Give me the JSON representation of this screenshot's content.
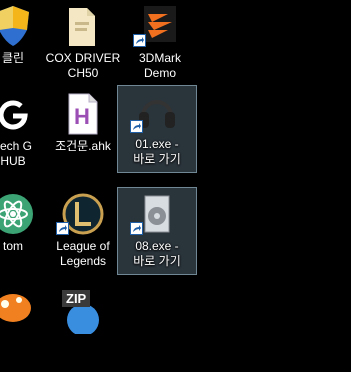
{
  "desktop": {
    "icons": [
      {
        "id": "clean",
        "label": "클린",
        "icon": "shield-cleaner-icon"
      },
      {
        "id": "cox",
        "label": "COX DRIVER\nCH50",
        "icon": "folder-icon"
      },
      {
        "id": "3dmark",
        "label": "3DMark\nDemo",
        "icon": "3dmark-icon"
      },
      {
        "id": "ghub",
        "label": "itech G\nHUB",
        "icon": "logitech-g-icon"
      },
      {
        "id": "ahk",
        "label": "조건문.ahk",
        "icon": "autohotkey-file-icon"
      },
      {
        "id": "exe01",
        "label": "01.exe -\n바로 가기",
        "icon": "headphones-icon",
        "selected": true
      },
      {
        "id": "atom",
        "label": "tom",
        "icon": "atom-icon"
      },
      {
        "id": "lol",
        "label": "League of\nLegends",
        "icon": "league-of-legends-icon"
      },
      {
        "id": "exe08",
        "label": "08.exe -\n바로 가기",
        "icon": "speaker-icon",
        "selected": true
      },
      {
        "id": "maple",
        "label": "",
        "icon": "mushroom-icon"
      },
      {
        "id": "zip",
        "label": "",
        "icon": "zip-icon",
        "badge": "ZIP"
      }
    ]
  },
  "colors": {
    "selection": "#5f7f95",
    "background": "#000000"
  }
}
